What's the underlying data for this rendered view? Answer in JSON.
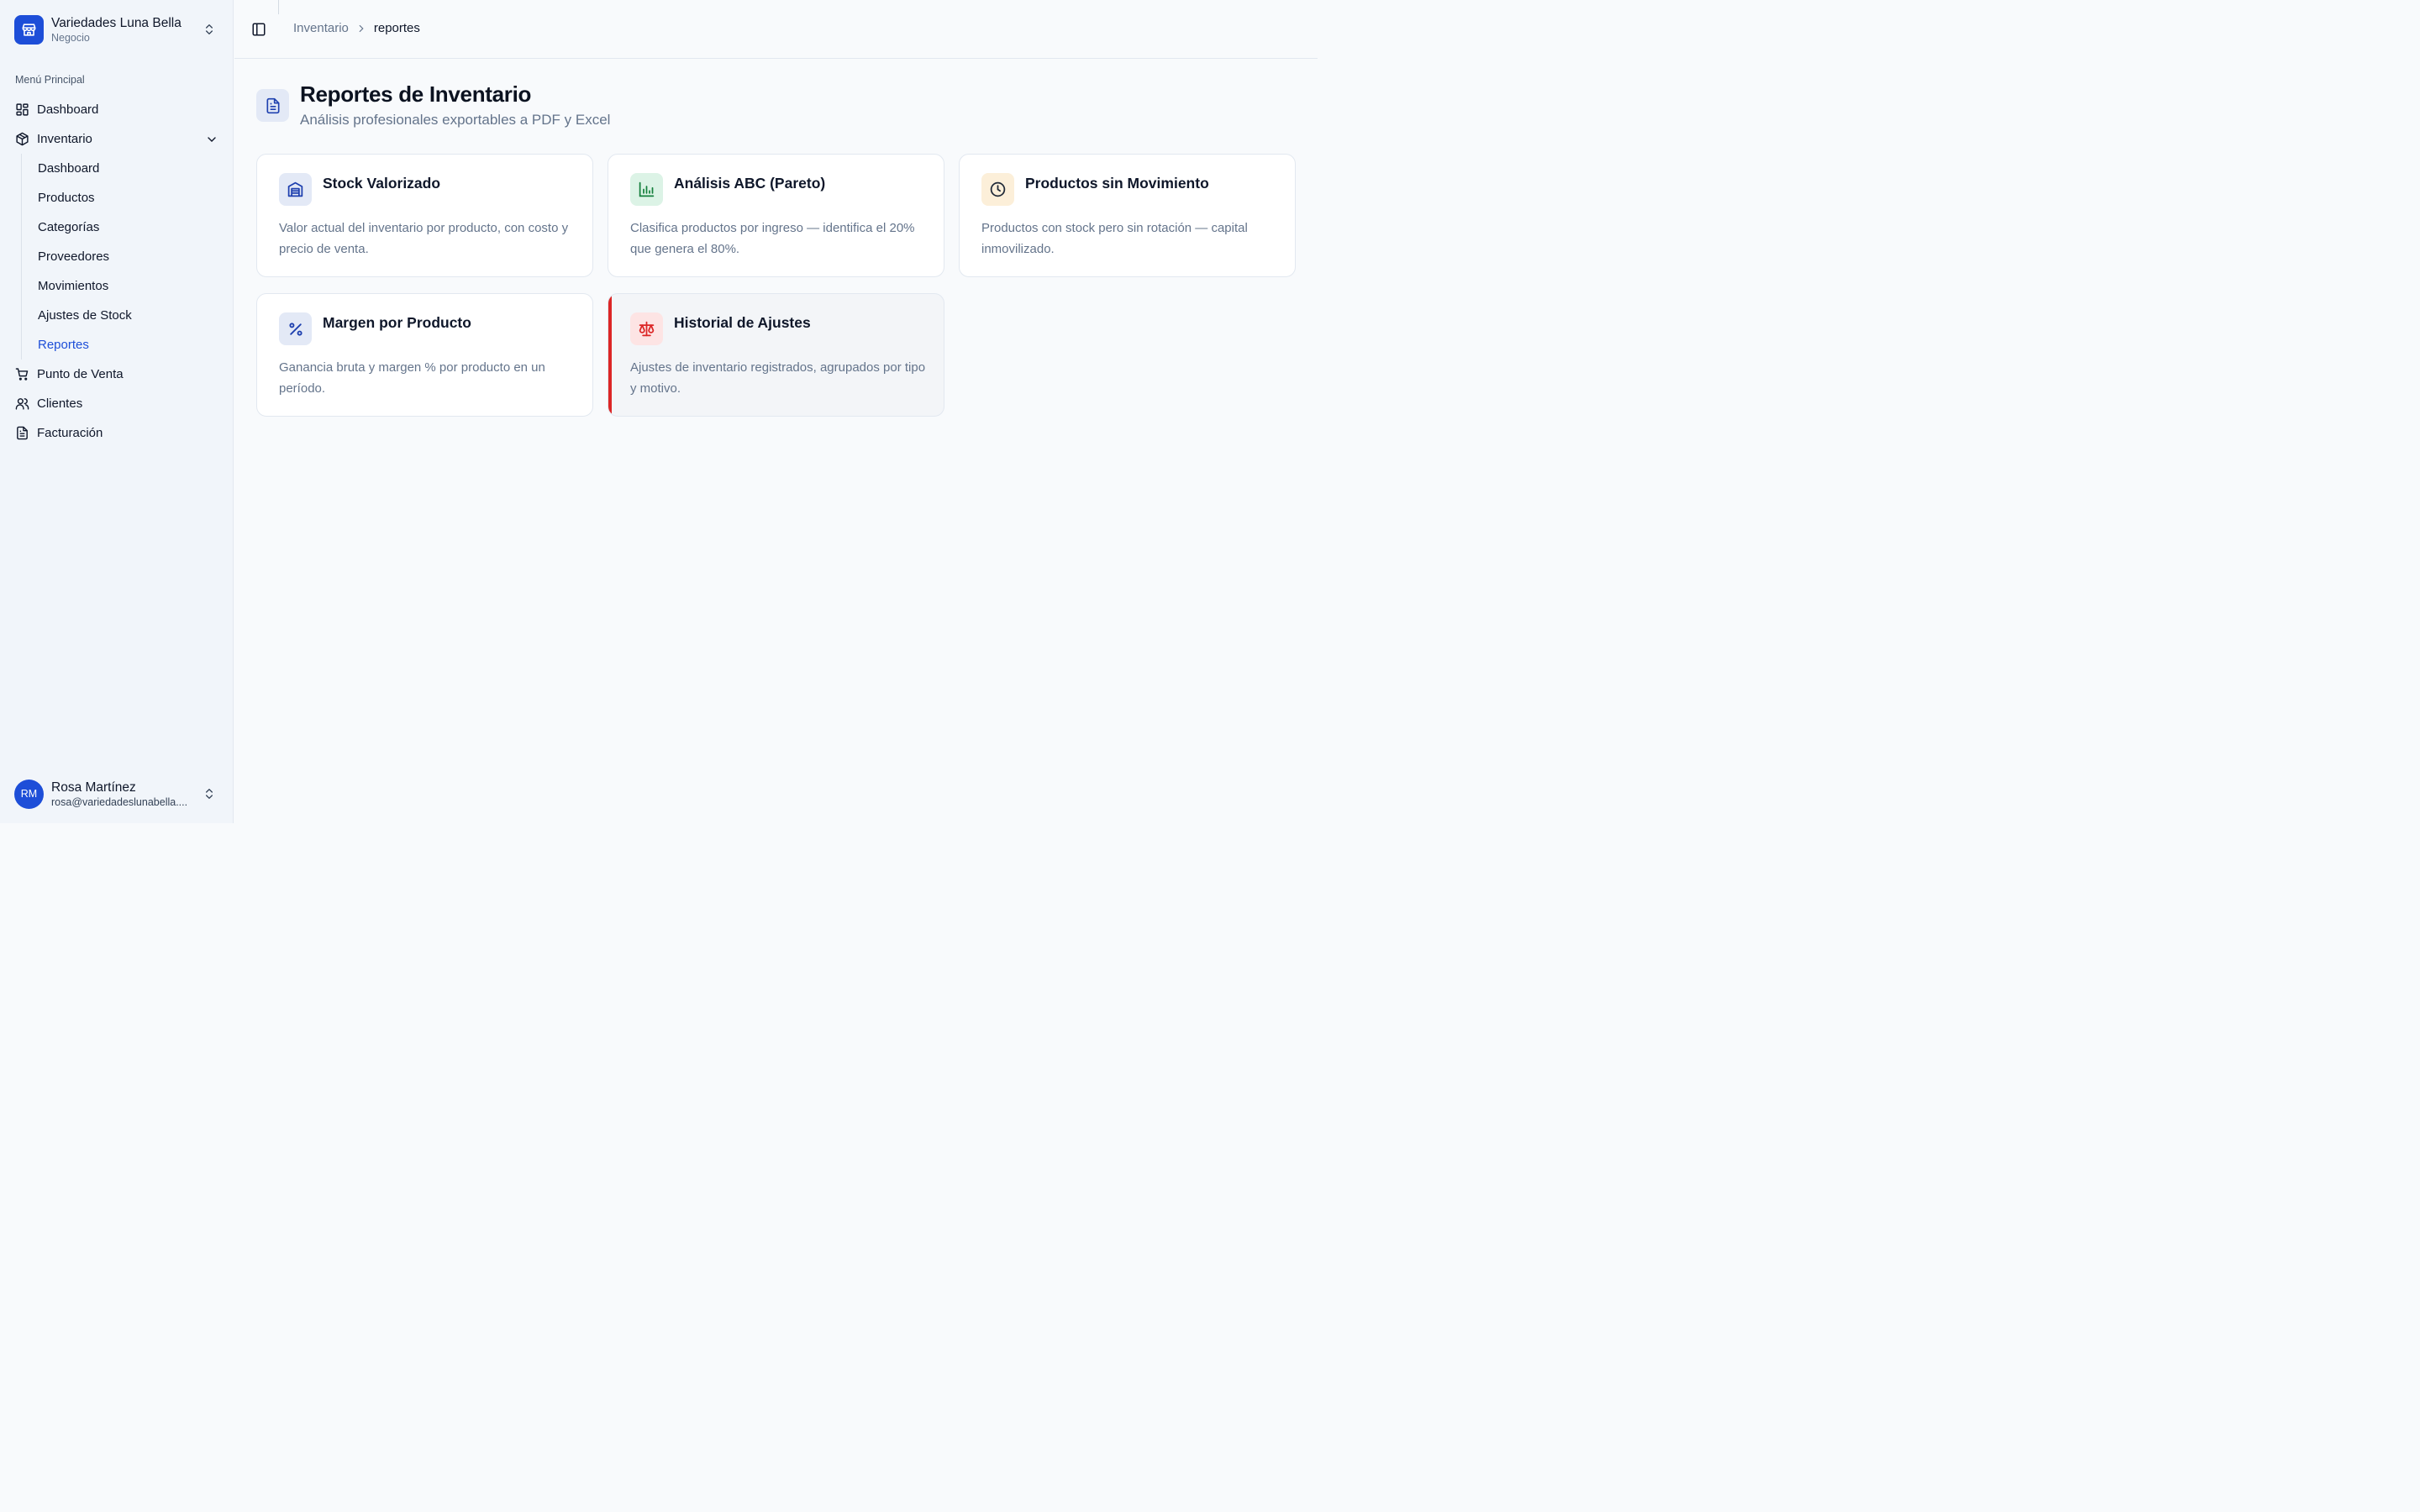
{
  "org": {
    "name": "Variedades Luna Bella",
    "subtitle": "Negocio",
    "icon": "store-icon"
  },
  "sidebar": {
    "group_label": "Menú Principal",
    "items": [
      {
        "label": "Dashboard",
        "icon": "layout-grid-icon"
      },
      {
        "label": "Inventario",
        "icon": "package-icon",
        "expanded": true
      },
      {
        "label": "Punto de Venta",
        "icon": "shopping-cart-icon"
      },
      {
        "label": "Clientes",
        "icon": "users-icon"
      },
      {
        "label": "Facturación",
        "icon": "file-text-icon"
      }
    ],
    "inventario_sub": [
      {
        "label": "Dashboard"
      },
      {
        "label": "Productos"
      },
      {
        "label": "Categorías"
      },
      {
        "label": "Proveedores"
      },
      {
        "label": "Movimientos"
      },
      {
        "label": "Ajustes de Stock"
      },
      {
        "label": "Reportes",
        "active": true
      }
    ]
  },
  "user": {
    "initials": "RM",
    "name": "Rosa Martínez",
    "email": "rosa@variedadeslunabella...."
  },
  "header": {
    "breadcrumb": {
      "parent": "Inventario",
      "current": "reportes"
    }
  },
  "page": {
    "title": "Reportes de Inventario",
    "subtitle": "Análisis profesionales exportables a PDF y Excel"
  },
  "cards": [
    {
      "title": "Stock Valorizado",
      "description": "Valor actual del inventario por producto, con costo y precio de venta.",
      "icon": "warehouse-icon",
      "icon_bg": "#e3e9f6",
      "icon_color": "#1e40af"
    },
    {
      "title": "Análisis ABC (Pareto)",
      "description": "Clasifica productos por ingreso — identifica el 20% que genera el 80%.",
      "icon": "bar-chart-icon",
      "icon_bg": "#dcf3e6",
      "icon_color": "#15803d"
    },
    {
      "title": "Productos sin Movimiento",
      "description": "Productos con stock pero sin rotación — capital inmovilizado.",
      "icon": "clock-icon",
      "icon_bg": "#fcefd9",
      "icon_color": "#1f2937"
    },
    {
      "title": "Margen por Producto",
      "description": "Ganancia bruta y margen % por producto en un período.",
      "icon": "percent-icon",
      "icon_bg": "#e3e9f6",
      "icon_color": "#1e40af"
    },
    {
      "title": "Historial de Ajustes",
      "description": "Ajustes de inventario registrados, agrupados por tipo y motivo.",
      "icon": "scale-icon",
      "icon_bg": "#fde4e4",
      "icon_color": "#dc2626",
      "accent": "#dc2626"
    }
  ]
}
